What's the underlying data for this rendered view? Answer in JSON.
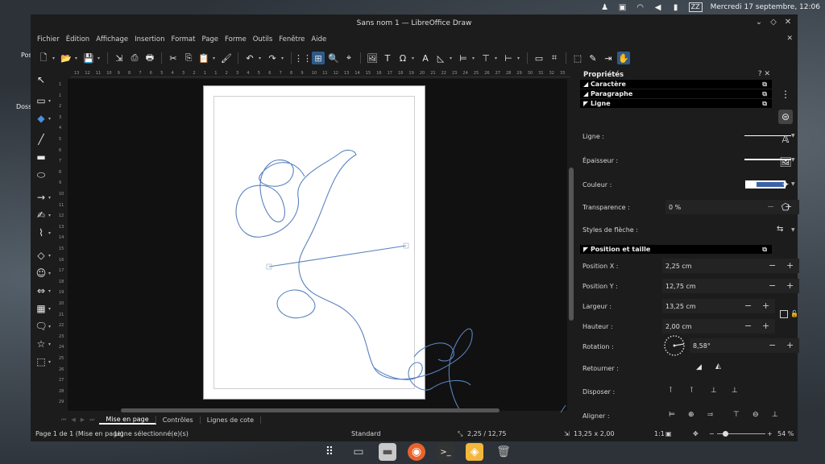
{
  "top_panel": {
    "datetime": "Mercredi 17 septembre, 12:06",
    "zz_label": "ZZ"
  },
  "desktop": {
    "icon_label_1": "Pos",
    "icon_label_2": "Doss"
  },
  "window": {
    "title": "Sans nom 1 — LibreOffice Draw"
  },
  "menubar": {
    "items": [
      "Fichier",
      "Édition",
      "Affichage",
      "Insertion",
      "Format",
      "Page",
      "Forme",
      "Outils",
      "Fenêtre",
      "Aide"
    ]
  },
  "hruler": {
    "ticks": [
      "13",
      "12",
      "11",
      "10",
      "9",
      "8",
      "7",
      "6",
      "5",
      "4",
      "3",
      "2",
      "1",
      "1",
      "2",
      "3",
      "4",
      "5",
      "6",
      "7",
      "8",
      "9",
      "10",
      "11",
      "12",
      "13",
      "14",
      "15",
      "16",
      "17",
      "18",
      "19",
      "20",
      "21",
      "22",
      "23",
      "24",
      "25",
      "26",
      "27",
      "28",
      "29",
      "30",
      "31",
      "32",
      "33"
    ]
  },
  "vruler": {
    "ticks": [
      "1",
      "1",
      "2",
      "3",
      "4",
      "5",
      "6",
      "7",
      "8",
      "9",
      "10",
      "11",
      "12",
      "13",
      "14",
      "15",
      "16",
      "17",
      "18",
      "19",
      "20",
      "21",
      "22",
      "23",
      "24",
      "25",
      "26",
      "27",
      "28",
      "29"
    ]
  },
  "tabs": {
    "items": [
      "Mise en page",
      "Contrôles",
      "Lignes de cote"
    ]
  },
  "statusbar": {
    "page": "Page 1 de 1 (Mise en page)",
    "selection": "Ligne sélectionné(e)(s)",
    "style": "Standard",
    "position": "2,25 / 12,75",
    "size": "13,25 x 2,00",
    "scale": "1:1",
    "zoom": "54 %"
  },
  "sidebar": {
    "title": "Propriétés",
    "sections": {
      "caractere": "Caractère",
      "paragraphe": "Paragraphe",
      "ligne": "Ligne",
      "position": "Position et taille"
    },
    "ligne_label": "Ligne :",
    "epaisseur_label": "Épaisseur :",
    "couleur_label": "Couleur :",
    "transparence_label": "Transparence :",
    "transparence_value": "0 %",
    "fleche_label": "Styles de flèche :",
    "posx_label": "Position X :",
    "posx_value": "2,25 cm",
    "posy_label": "Position Y :",
    "posy_value": "12,75 cm",
    "largeur_label": "Largeur :",
    "largeur_value": "13,25 cm",
    "hauteur_label": "Hauteur :",
    "hauteur_value": "2,00 cm",
    "rotation_label": "Rotation :",
    "rotation_value": "8,58°",
    "retourner_label": "Retourner :",
    "disposer_label": "Disposer :",
    "aligner_label": "Aligner :",
    "line_color": "#3b62a8"
  },
  "drawing": {
    "stroke_color": "#5a82bf"
  }
}
